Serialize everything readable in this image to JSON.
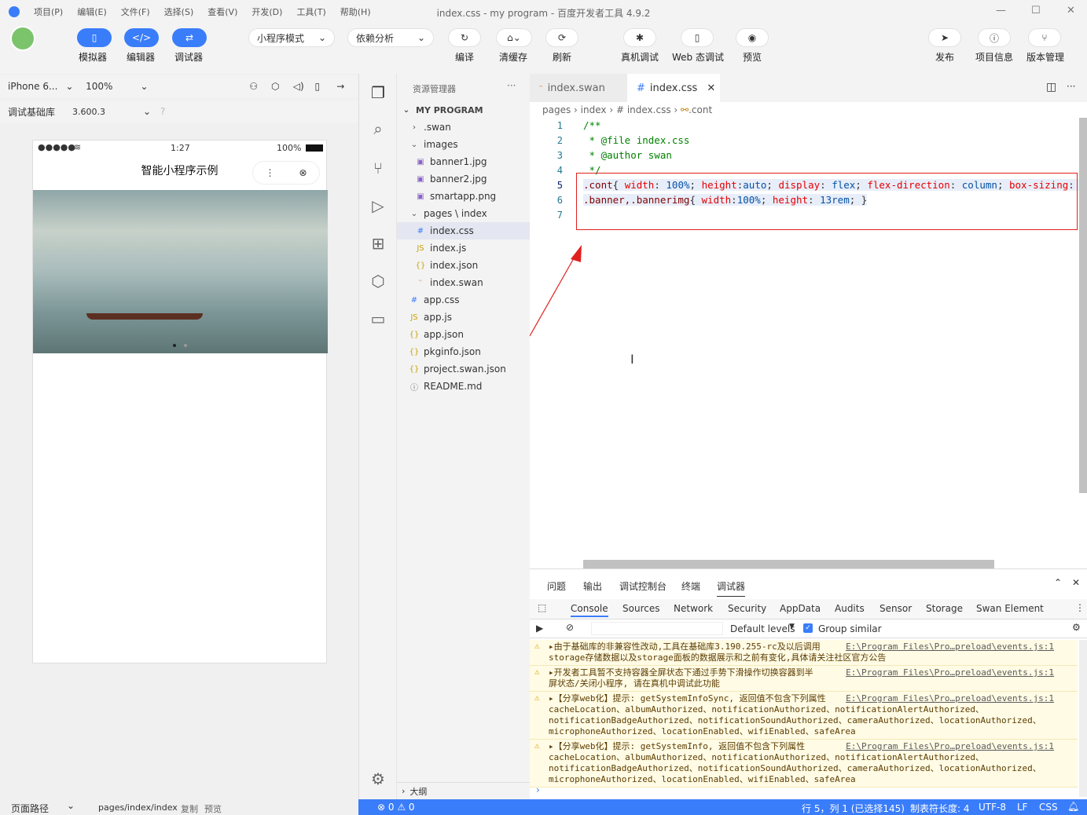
{
  "window": {
    "title": "index.css - my program - 百度开发者工具 4.9.2"
  },
  "menu": [
    "项目(P)",
    "编辑(E)",
    "文件(F)",
    "选择(S)",
    "查看(V)",
    "开发(D)",
    "工具(T)",
    "帮助(H)"
  ],
  "toolbar": {
    "simulator": "模拟器",
    "editor": "编辑器",
    "debugger": "调试器",
    "mode": "小程序模式",
    "deps": "依赖分析",
    "compile": "编译",
    "clear_cache": "清缓存",
    "refresh": "刷新",
    "device_debug": "真机调试",
    "web_debug": "Web 态调试",
    "preview": "预览",
    "publish": "发布",
    "project_info": "项目信息",
    "version_mgmt": "版本管理"
  },
  "simulator": {
    "device": "iPhone 6...",
    "zoom": "100%",
    "lib_label": "调试基础库",
    "lib_version": "3.600.3",
    "status_time": "1:27",
    "battery": "100%",
    "signal": "●●●●●",
    "page_title": "智能小程序示例"
  },
  "explorer": {
    "title": "资源管理器",
    "project": "MY PROGRAM",
    "outline": "大纲",
    "items": [
      {
        "name": ".swan",
        "type": "folder",
        "depth": 1
      },
      {
        "name": "images",
        "type": "folder-open",
        "depth": 1
      },
      {
        "name": "banner1.jpg",
        "type": "img",
        "depth": 2
      },
      {
        "name": "banner2.jpg",
        "type": "img",
        "depth": 2
      },
      {
        "name": "smartapp.png",
        "type": "img",
        "depth": 2
      },
      {
        "name": "pages \\ index",
        "type": "folder-open",
        "depth": 1
      },
      {
        "name": "index.css",
        "type": "css",
        "depth": 2
      },
      {
        "name": "index.js",
        "type": "js",
        "depth": 2
      },
      {
        "name": "index.json",
        "type": "json",
        "depth": 2
      },
      {
        "name": "index.swan",
        "type": "swan",
        "depth": 2
      },
      {
        "name": "app.css",
        "type": "css",
        "depth": 1
      },
      {
        "name": "app.js",
        "type": "js",
        "depth": 1
      },
      {
        "name": "app.json",
        "type": "json",
        "depth": 1
      },
      {
        "name": "pkginfo.json",
        "type": "json",
        "depth": 1
      },
      {
        "name": "project.swan.json",
        "type": "json",
        "depth": 1
      },
      {
        "name": "README.md",
        "type": "info",
        "depth": 1
      }
    ]
  },
  "editor": {
    "tabs": [
      "index.swan",
      "index.css"
    ],
    "breadcrumb": [
      "pages",
      "index",
      "# index.css",
      ".cont"
    ],
    "lines": [
      "1",
      "2",
      "3",
      "4",
      "5",
      "6",
      "7"
    ]
  },
  "devtools": {
    "panel_tabs": [
      "问题",
      "输出",
      "调试控制台",
      "终端",
      "调试器"
    ],
    "tabs": [
      "Console",
      "Sources",
      "Network",
      "Security",
      "AppData",
      "Audits",
      "Sensor",
      "Storage",
      "Swan Element"
    ],
    "levels": "Default levels",
    "group": "Group similar",
    "link": "E:\\Program Files\\Pro…preload\\events.js:1",
    "messages": [
      "▸由于基础库的非兼容性改动,工具在基础库3.190.255-rc及以后调用\nstorage存储数据以及storage面板的数据展示和之前有变化,具体请关注社区官方公告",
      "▸开发者工具暂不支持容器全屏状态下通过手势下滑操作切换容器到半\n屏状态/关闭小程序, 请在真机中调试此功能",
      "▸【分享web化】提示: getSystemInfoSync, 返回值不包含下列属性\ncacheLocation、albumAuthorized、notificationAuthorized、notificationAlertAuthorized、\nnotificationBadgeAuthorized、notificationSoundAuthorized、cameraAuthorized、locationAuthorized、\nmicrophoneAuthorized、locationEnabled、wifiEnabled、safeArea",
      "▸【分享web化】提示: getSystemInfo, 返回值不包含下列属性\ncacheLocation、albumAuthorized、notificationAuthorized、notificationAlertAuthorized、\nnotificationBadgeAuthorized、notificationSoundAuthorized、cameraAuthorized、locationAuthorized、\nmicrophoneAuthorized、locationEnabled、wifiEnabled、safeArea"
    ]
  },
  "status": {
    "page_path_label": "页面路径",
    "page_path": "pages/index/index",
    "copy": "复制",
    "preview": "预览",
    "errors": "⊗ 0 ⚠ 0",
    "position": "行 5，列 1 (已选择145)",
    "tab_size": "制表符长度: 4",
    "encoding": "UTF-8",
    "eol": "LF",
    "lang": "CSS"
  },
  "colors": {
    "accent": "#3a7dfa",
    "highlight_box": "#e02020"
  }
}
